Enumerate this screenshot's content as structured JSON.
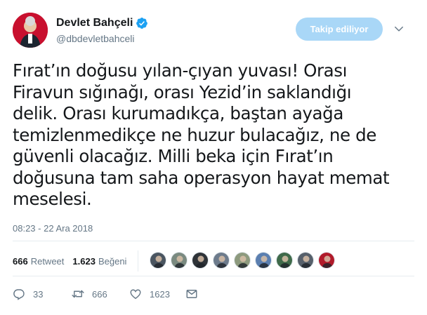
{
  "user": {
    "name": "Devlet Bahçeli",
    "handle": "@dbdevletbahceli",
    "verified": true,
    "avatar_color": "#c8102e"
  },
  "follow_button": {
    "label": "Takip ediliyor",
    "color": "#a9d7f7"
  },
  "tweet": {
    "lines": [
      "Fırat’ın doğusu yılan-çıyan yuvası! Orası",
      "Firavun sığınağı, orası Yezid’in saklandığı",
      "delik. Orası kurumadıkça, baştan ayağa",
      "temizlenmedikçe ne huzur bulacağız, ne de",
      "güvenli olacağız. Milli beka için Fırat’ın",
      "doğusuna tam saha operasyon hayat memat",
      "meselesi."
    ],
    "timestamp": "08:23 - 22 Ara 2018"
  },
  "stats": {
    "retweets": {
      "count": "666",
      "label": "Retweet"
    },
    "likes": {
      "count": "1.623",
      "label": "Beğeni"
    }
  },
  "liker_avatars": [
    {
      "name": "liker-avatar-1",
      "color": "#4a5560"
    },
    {
      "name": "liker-avatar-2",
      "color": "#7a8a80"
    },
    {
      "name": "liker-avatar-3",
      "color": "#2e3338"
    },
    {
      "name": "liker-avatar-4",
      "color": "#6d7b8c"
    },
    {
      "name": "liker-avatar-5",
      "color": "#8d9a7e"
    },
    {
      "name": "liker-avatar-6",
      "color": "#5b7fb0"
    },
    {
      "name": "liker-avatar-7",
      "color": "#3f6a4a"
    },
    {
      "name": "liker-avatar-8",
      "color": "#56606b"
    },
    {
      "name": "liker-avatar-9",
      "color": "#b01a2a"
    }
  ],
  "actions": {
    "reply": {
      "count": "33",
      "icon": "reply-icon"
    },
    "retweet": {
      "count": "666",
      "icon": "retweet-icon"
    },
    "like": {
      "count": "1623",
      "icon": "heart-icon"
    },
    "message": {
      "icon": "envelope-icon"
    }
  }
}
